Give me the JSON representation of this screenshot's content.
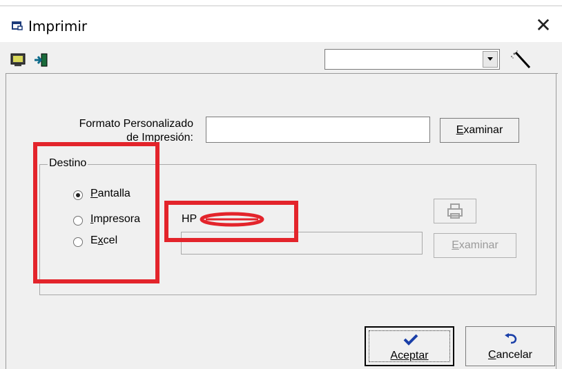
{
  "window": {
    "title": "Imprimir",
    "close_glyph": "✕"
  },
  "toolbar": {
    "screen_icon": "monitor-icon",
    "exit_icon": "exit-door-icon",
    "combo_value": "",
    "wand_icon": "magic-wand-icon"
  },
  "form": {
    "format_label_line1": "Formato Personalizado",
    "format_label_line2": "de Impresión:",
    "format_value": "",
    "examinar_label": "Examinar"
  },
  "destino": {
    "title": "Destino",
    "options": [
      {
        "label": "Pantalla",
        "checked": true
      },
      {
        "label": "Impresora",
        "checked": false
      },
      {
        "label": "Excel",
        "checked": false
      }
    ],
    "printer_name": "HP",
    "printer_path": "",
    "printer_icon": "printer-icon",
    "examinar_label": "Examinar"
  },
  "footer": {
    "accept_label": "Aceptar",
    "cancel_label": "Cancelar"
  },
  "colors": {
    "highlight": "#e3242b",
    "accept_check": "#1a3fa8"
  }
}
